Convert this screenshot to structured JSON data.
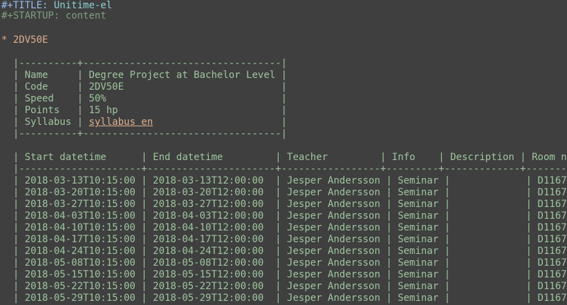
{
  "header": {
    "title_keyword": "#+TITLE:",
    "title_value": "Unitime-el",
    "startup_keyword": "#+STARTUP:",
    "startup_value": "content"
  },
  "heading": {
    "stars": "*",
    "text": "2DV50E"
  },
  "info_table": {
    "top_border": "|----------+----------------------------------|",
    "rows": [
      {
        "key": "Name",
        "value": "Degree Project at Bachelor Level"
      },
      {
        "key": "Code",
        "value": "2DV50E"
      },
      {
        "key": "Speed",
        "value": "50%"
      },
      {
        "key": "Points",
        "value": "15 hp"
      },
      {
        "key": "Syllabus",
        "link": "syllabus en"
      }
    ],
    "bottom_border": "|----------+----------------------------------|"
  },
  "schedule_table": {
    "columns": [
      "Start datetime",
      "End datetime",
      "Teacher",
      "Info",
      "Description",
      "Room name"
    ],
    "separator": "|---------------------+----------------------+-----------------+---------+-------------+-----------",
    "rows": [
      [
        "2018-03-13T10:15:00",
        "2018-03-13T12:00:00",
        "Jesper Andersson",
        "Seminar",
        "",
        "D1167"
      ],
      [
        "2018-03-20T10:15:00",
        "2018-03-20T12:00:00",
        "Jesper Andersson",
        "Seminar",
        "",
        "D1167"
      ],
      [
        "2018-03-27T10:15:00",
        "2018-03-27T12:00:00",
        "Jesper Andersson",
        "Seminar",
        "",
        "D1167"
      ],
      [
        "2018-04-03T10:15:00",
        "2018-04-03T12:00:00",
        "Jesper Andersson",
        "Seminar",
        "",
        "D1167"
      ],
      [
        "2018-04-10T10:15:00",
        "2018-04-10T12:00:00",
        "Jesper Andersson",
        "Seminar",
        "",
        "D1167"
      ],
      [
        "2018-04-17T10:15:00",
        "2018-04-17T12:00:00",
        "Jesper Andersson",
        "Seminar",
        "",
        "D1167"
      ],
      [
        "2018-04-24T10:15:00",
        "2018-04-24T12:00:00",
        "Jesper Andersson",
        "Seminar",
        "",
        "D1167"
      ],
      [
        "2018-05-08T10:15:00",
        "2018-05-08T12:00:00",
        "Jesper Andersson",
        "Seminar",
        "",
        "D1167"
      ],
      [
        "2018-05-15T10:15:00",
        "2018-05-15T12:00:00",
        "Jesper Andersson",
        "Seminar",
        "",
        "D1167"
      ],
      [
        "2018-05-22T10:15:00",
        "2018-05-22T12:00:00",
        "Jesper Andersson",
        "Seminar",
        "",
        "D1167"
      ],
      [
        "2018-05-29T10:15:00",
        "2018-05-29T12:00:00",
        "Jesper Andersson",
        "Seminar",
        "",
        "D1167"
      ]
    ]
  }
}
